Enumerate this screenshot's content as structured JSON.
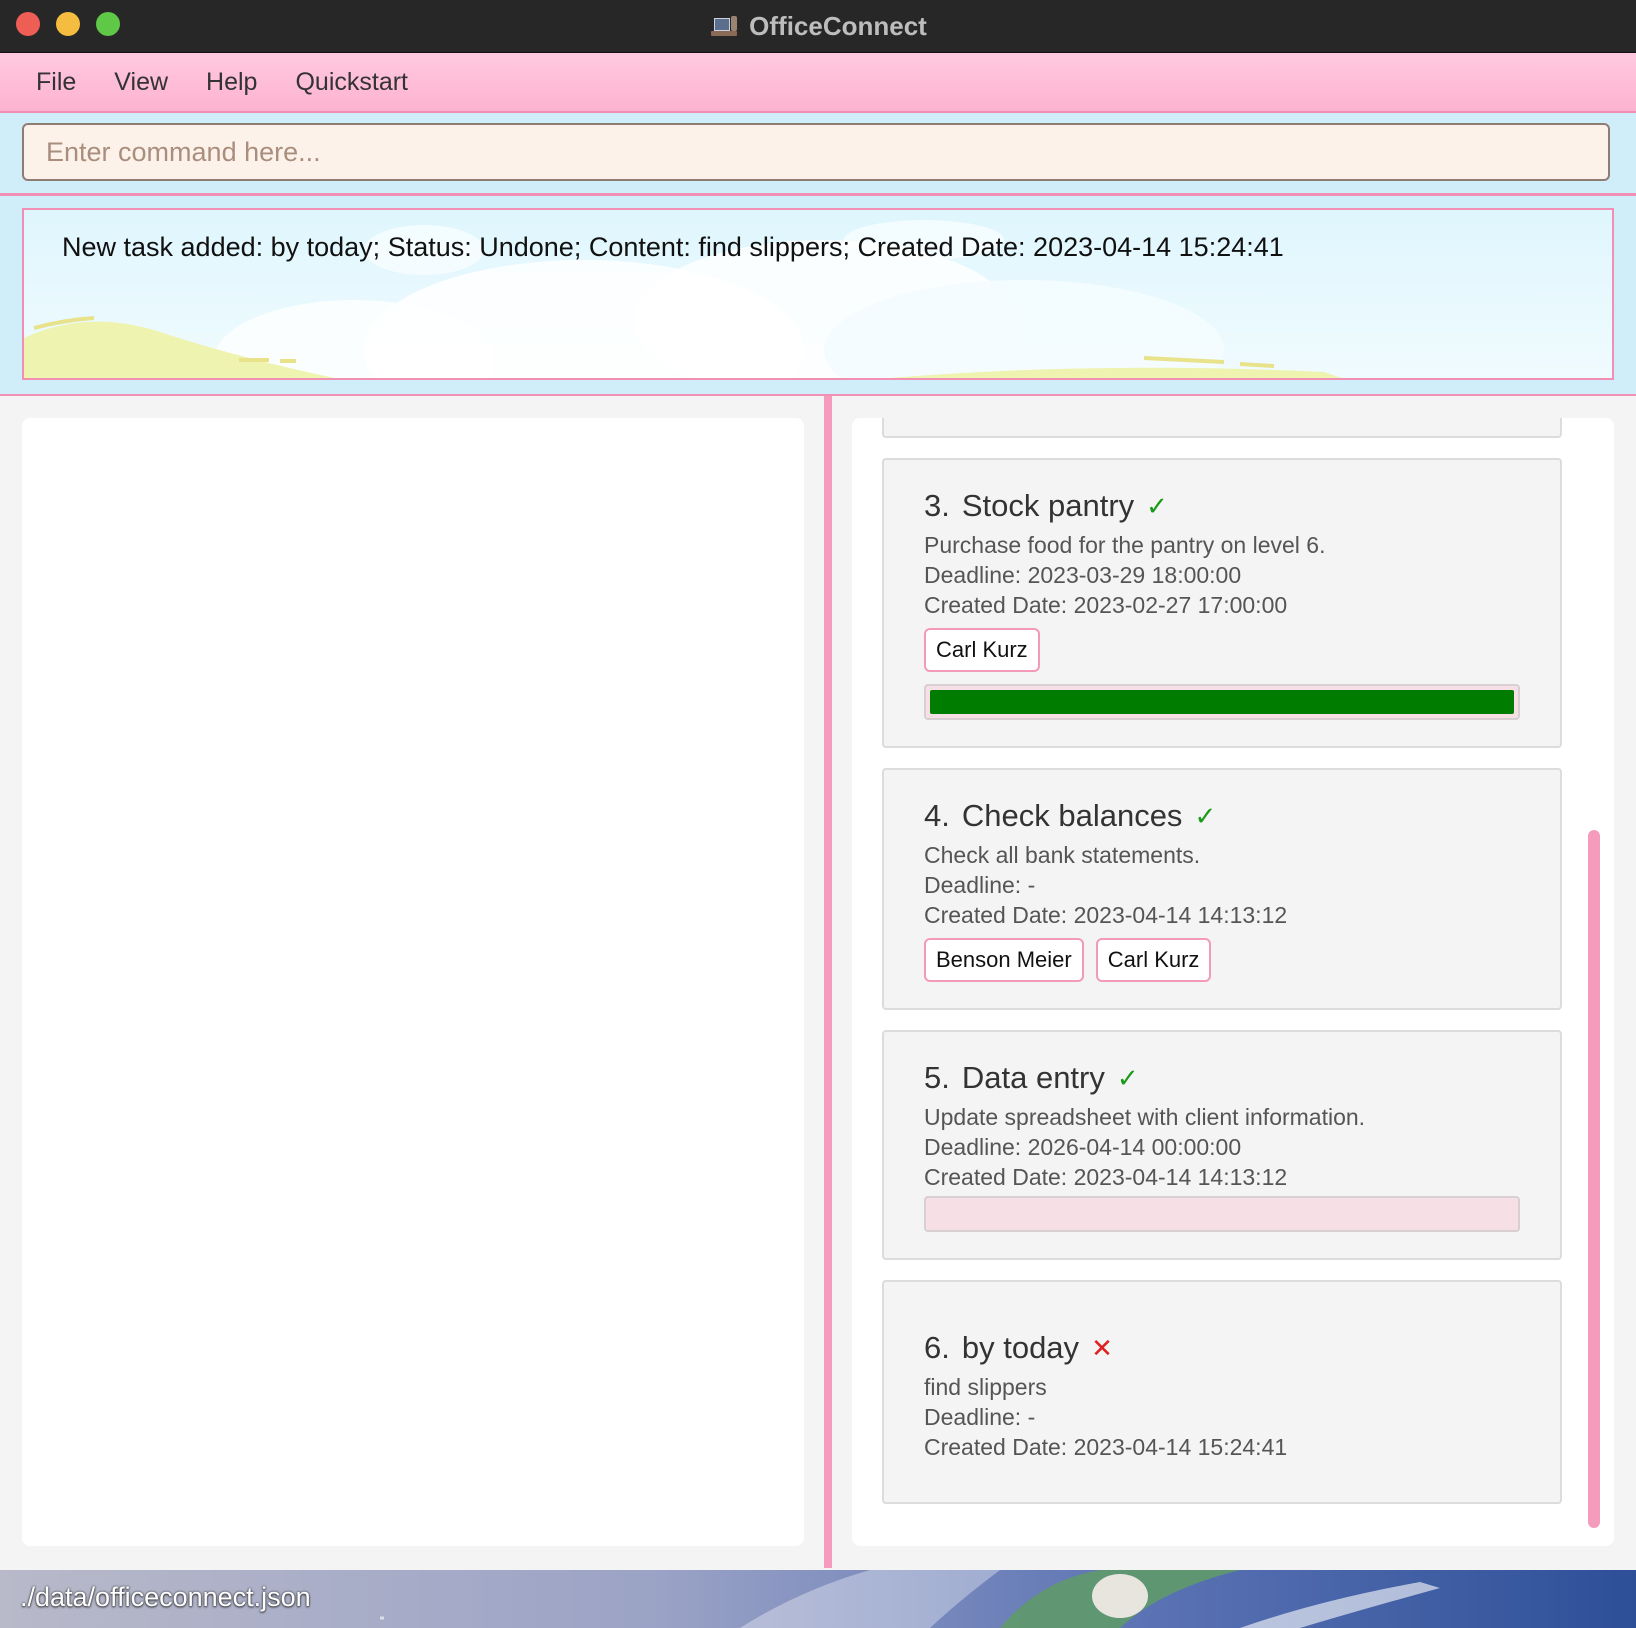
{
  "window": {
    "title": "OfficeConnect"
  },
  "menu": {
    "items": [
      "File",
      "View",
      "Help",
      "Quickstart"
    ]
  },
  "command": {
    "placeholder": "Enter command here...",
    "value": ""
  },
  "result": {
    "text": "New task added: by today; Status: Undone; Content: find slippers; Created Date: 2023-04-14 15:24:41"
  },
  "tasks": [
    {
      "index": "3.",
      "title": "Stock pantry",
      "status": "✓",
      "content": "Purchase food for the pantry on level 6.",
      "deadline": "Deadline: 2023-03-29 18:00:00",
      "created": "Created Date: 2023-02-27 17:00:00",
      "tags": [
        "Carl Kurz"
      ],
      "progress": 1.0
    },
    {
      "index": "4.",
      "title": "Check balances",
      "status": "✓",
      "content": "Check all bank statements.",
      "deadline": "Deadline: -",
      "created": "Created Date: 2023-04-14 14:13:12",
      "tags": [
        "Benson Meier",
        "Carl Kurz"
      ]
    },
    {
      "index": "5.",
      "title": "Data entry",
      "status": "✓",
      "content": "Update spreadsheet with client information.",
      "deadline": "Deadline: 2026-04-14 00:00:00",
      "created": "Created Date: 2023-04-14 14:13:12",
      "tags": [],
      "progress": 0.0
    },
    {
      "index": "6.",
      "title": "by today",
      "status": "✕",
      "content": "find slippers",
      "deadline": "Deadline: -",
      "created": "Created Date: 2023-04-14 15:24:41",
      "tags": []
    }
  ],
  "status_bar": {
    "path": "./data/officeconnect.json"
  },
  "colors": {
    "accent_pink": "#f59cbc",
    "progress_done": "#007d00",
    "status_done": "#1a9a1a",
    "status_undone": "#e02020"
  }
}
